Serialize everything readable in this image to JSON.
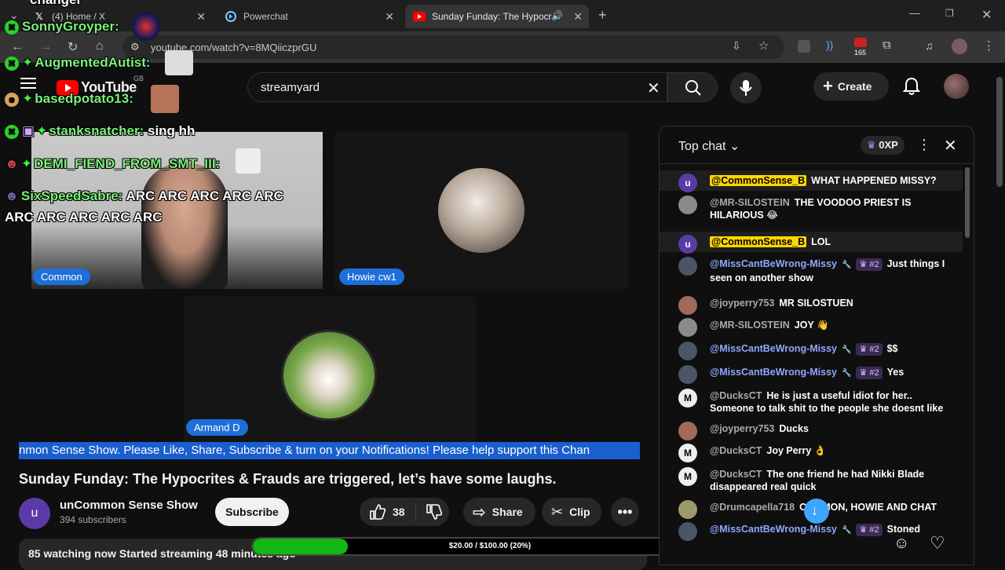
{
  "browser": {
    "tabs": [
      {
        "label": "(4) Home / X",
        "icon": "x-logo-icon",
        "active": false
      },
      {
        "label": "Powerchat",
        "icon": "powerchat-icon",
        "active": false
      },
      {
        "label": "Sunday Funday: The Hypocr",
        "icon": "youtube-icon",
        "active": true
      }
    ],
    "url": "youtube.com/watch?v=8MQiiczprGU",
    "extension_badge": "165"
  },
  "header": {
    "logo_text": "YouTube",
    "region": "GB",
    "search_value": "streamyard",
    "create_label": "Create"
  },
  "overlay": {
    "top_text": "changer",
    "lines": [
      {
        "user": "SonnyGroyper:",
        "msg": ""
      },
      {
        "user": "AugmentedAutist:",
        "msg": ""
      },
      {
        "user": "basedpotato13:",
        "msg": ""
      },
      {
        "user": "stanksnatcher:",
        "msg": "sing hh"
      },
      {
        "user": "DEMI_FIEND_FROM_SMT_III:",
        "msg": ""
      },
      {
        "user": "SixSpeedSabre:",
        "msg": "ARC ARC ARC ARC ARC"
      }
    ],
    "wrap_line": "ARC ARC ARC ARC ARC"
  },
  "cams": [
    {
      "name": "Common"
    },
    {
      "name": "Howie cw1"
    },
    {
      "name": "Armand D"
    }
  ],
  "ticker": "nmon Sense Show. Please Like, Share, Subscribe & turn on your Notifications! Please help support this Chan",
  "video": {
    "title": "Sunday Funday: The Hypocrites & Frauds are triggered, let’s have some laughs.",
    "channel_initial": "u",
    "channel_name": "unCommon Sense Show",
    "subscribers": "394 subscribers",
    "subscribe_label": "Subscribe",
    "likes": "38",
    "share_label": "Share",
    "clip_label": "Clip",
    "watching": "85 watching now  Started streaming 48 minutes ago"
  },
  "goal": {
    "text": "$20.00 / $100.00 (20%)",
    "progress": 0.2
  },
  "chat": {
    "title": "Top chat",
    "xp": "0XP",
    "messages": [
      {
        "author": "@CommonSense_B",
        "kind": "owner",
        "text": "WHAT HAPPENED MISSY?",
        "rank": "",
        "avatar": "#5b3aa8",
        "initial": "u"
      },
      {
        "author": "@MR-SILOSTEIN",
        "kind": "normal",
        "text": "THE VOODOO PRIEST IS HILARIOUS 😂",
        "rank": "",
        "avatar": "#8a8a8a",
        "initial": ""
      },
      {
        "author": "@CommonSense_B",
        "kind": "owner",
        "text": "LOL",
        "rank": "",
        "avatar": "#5b3aa8",
        "initial": "u"
      },
      {
        "author": "@MissCantBeWrong-Missy",
        "kind": "mod",
        "text": "Just things I seen on another show",
        "rank": "#2",
        "avatar": "#4a5666",
        "initial": ""
      },
      {
        "author": "@joyperry753",
        "kind": "normal",
        "text": "MR SILOSTUEN",
        "rank": "",
        "avatar": "#a06a5a",
        "initial": ""
      },
      {
        "author": "@MR-SILOSTEIN",
        "kind": "normal",
        "text": "JOY 👋",
        "rank": "",
        "avatar": "#8a8a8a",
        "initial": ""
      },
      {
        "author": "@MissCantBeWrong-Missy",
        "kind": "mod",
        "text": "$$",
        "rank": "#2",
        "avatar": "#4a5666",
        "initial": ""
      },
      {
        "author": "@MissCantBeWrong-Missy",
        "kind": "mod",
        "text": "Yes",
        "rank": "#2",
        "avatar": "#4a5666",
        "initial": ""
      },
      {
        "author": "@DucksCT",
        "kind": "normal",
        "text": "He is just a useful idiot for her.. Someone to talk shit to the people she doesnt like",
        "rank": "",
        "avatar": "#eeeeee",
        "initial": "M"
      },
      {
        "author": "@joyperry753",
        "kind": "normal",
        "text": "Ducks",
        "rank": "",
        "avatar": "#a06a5a",
        "initial": ""
      },
      {
        "author": "@DucksCT",
        "kind": "normal",
        "text": "Joy Perry 👌",
        "rank": "",
        "avatar": "#eeeeee",
        "initial": "M"
      },
      {
        "author": "@DucksCT",
        "kind": "normal",
        "text": "The one friend he had Nikki Blade disappeared real quick",
        "rank": "",
        "avatar": "#eeeeee",
        "initial": "M"
      },
      {
        "author": "@Drumcapella718",
        "kind": "normal",
        "text": "COMMON, HOWIE AND CHAT",
        "rank": "",
        "avatar": "#9a9a6a",
        "initial": ""
      },
      {
        "author": "@MissCantBeWrong-Missy",
        "kind": "mod",
        "text": "Stoned",
        "rank": "#2",
        "avatar": "#4a5666",
        "initial": ""
      }
    ]
  }
}
